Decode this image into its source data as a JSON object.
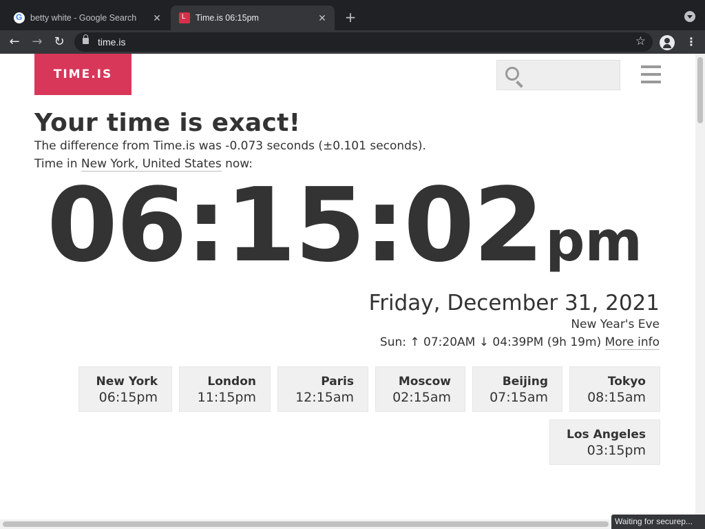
{
  "browser": {
    "tabs": [
      {
        "title": "betty white - Google Search",
        "active": false
      },
      {
        "title": "Time.is 06:15pm",
        "active": true
      }
    ],
    "url": "time.is",
    "status_text": "Waiting for securep..."
  },
  "site": {
    "logo": "TIME.IS",
    "search_placeholder": ""
  },
  "main": {
    "headline": "Your time is exact!",
    "difference": "The difference from Time.is was -0.073 seconds (±0.101 seconds).",
    "time_in_prefix": "Time in ",
    "location": "New York, United States",
    "time_in_suffix": " now:",
    "clock_digits": "06:15:02",
    "clock_ampm": "pm",
    "date": "Friday, December 31, 2021",
    "holiday": "New Year's Eve",
    "sun_text": "Sun: ↑ 07:20AM ↓ 04:39PM (9h 19m) ",
    "more_info": "More info"
  },
  "cities": [
    {
      "name": "New York",
      "time": "06:15pm"
    },
    {
      "name": "London",
      "time": "11:15pm"
    },
    {
      "name": "Paris",
      "time": "12:15am"
    },
    {
      "name": "Moscow",
      "time": "02:15am"
    },
    {
      "name": "Beijing",
      "time": "07:15am"
    },
    {
      "name": "Tokyo",
      "time": "08:15am"
    },
    {
      "name": "Los Angeles",
      "time": "03:15pm"
    }
  ],
  "colors": {
    "logo_bg": "#d8375a",
    "text": "#333333",
    "city_bg": "#f0f0f0"
  }
}
